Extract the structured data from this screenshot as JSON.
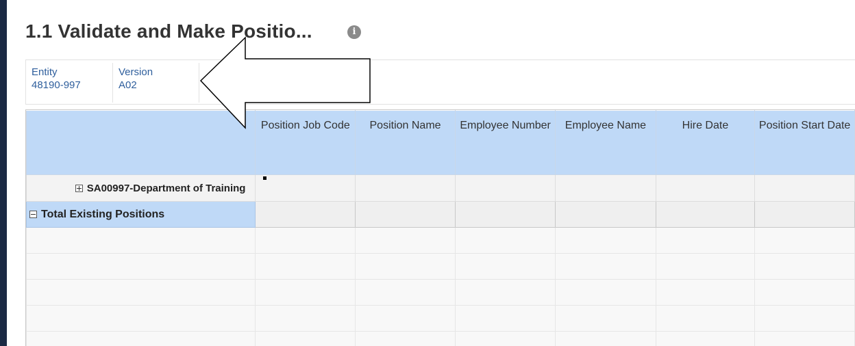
{
  "page": {
    "title": "1.1 Validate and Make Positio...",
    "info_icon": "info-icon"
  },
  "pov": [
    {
      "label": "Entity",
      "value": "48190-997"
    },
    {
      "label": "Version",
      "value": "A02"
    }
  ],
  "grid": {
    "columns": [
      "Position Job Code",
      "Position Name",
      "Employee Number",
      "Employee Name",
      "Hire Date",
      "Position Start Date"
    ],
    "rows": [
      {
        "label": "SA00997-Department of Training",
        "expander": "plus"
      },
      {
        "label": "Total Existing Positions",
        "expander": "minus"
      }
    ]
  },
  "annotation": {
    "arrow_direction": "left",
    "arrow_color": "#ffffff",
    "arrow_outline": "#000000"
  },
  "colors": {
    "header_bg": "#bfd9f7",
    "link_text": "#2e5e9c",
    "left_bar": "#1b2a44"
  }
}
